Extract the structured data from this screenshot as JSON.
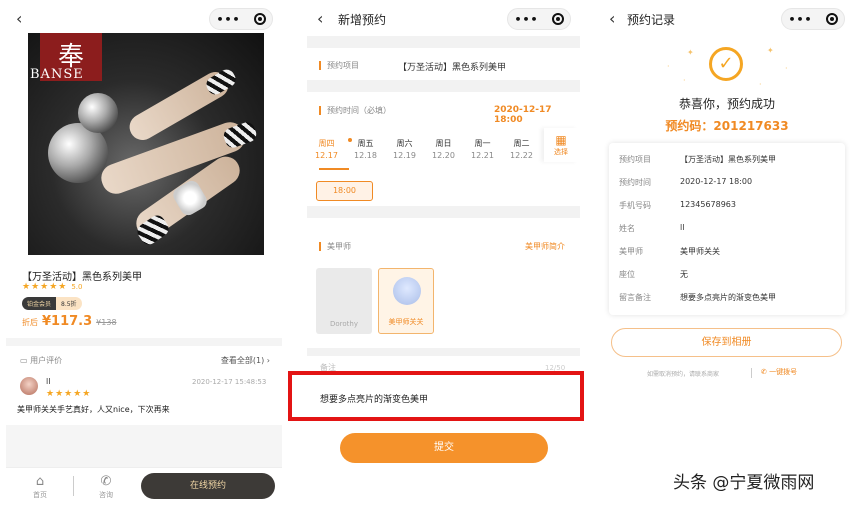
{
  "panel1": {
    "product_title": "【万圣活动】黑色系列美甲",
    "stars": "★★★★★",
    "rating": "5.0",
    "member_badge": "铂金会员",
    "discount_badge": "8.5折",
    "price_label": "折后",
    "price": "¥117.3",
    "original_price": "¥138",
    "reviews_label": "用户评价",
    "view_all": "查看全部(1)",
    "review": {
      "name": "ll",
      "date": "2020-12-17 15:48:53",
      "stars": "★★★★★",
      "text": "美甲师关关手艺真好，人又nice，下次再来"
    },
    "tabs": [
      {
        "label": "首页",
        "icon": "⌂"
      },
      {
        "label": "咨询",
        "icon": "✆"
      }
    ],
    "book_button": "在线预约",
    "photo_logo_char": "奉",
    "photo_logo_text": "BANSE"
  },
  "panel2": {
    "title": "新增预约",
    "project_label": "预约项目",
    "project_value": "【万圣活动】黑色系列美甲",
    "time_label": "预约时间（必填）",
    "time_value": "2020-12-17 18:00",
    "days": [
      {
        "week": "周四",
        "date": "12.17"
      },
      {
        "week": "周五",
        "date": "12.18"
      },
      {
        "week": "周六",
        "date": "12.19"
      },
      {
        "week": "周日",
        "date": "12.20"
      },
      {
        "week": "周一",
        "date": "12.21"
      },
      {
        "week": "周二",
        "date": "12.22"
      }
    ],
    "calendar_label": "选择",
    "time_chip": "18:00",
    "tech_label": "美甲师",
    "tech_intro": "美甲师简介",
    "techs": [
      {
        "name": "Dorothy"
      },
      {
        "name": "美甲师关关"
      }
    ],
    "note_label": "备注",
    "note_count": "12/50",
    "note_text": "想要多点亮片的渐变色美甲",
    "submit": "提交"
  },
  "panel3": {
    "title": "预约记录",
    "success": "恭喜你，预约成功",
    "code_label": "预约码：",
    "code": "201217633",
    "rows": [
      {
        "k": "预约项目",
        "v": "【万圣活动】黑色系列美甲"
      },
      {
        "k": "预约时间",
        "v": "2020-12-17 18:00"
      },
      {
        "k": "手机号码",
        "v": "12345678963"
      },
      {
        "k": "姓名",
        "v": "ll"
      },
      {
        "k": "美甲师",
        "v": "美甲师关关"
      },
      {
        "k": "座位",
        "v": "无"
      },
      {
        "k": "留言备注",
        "v": "想要多点亮片的渐变色美甲"
      }
    ],
    "save_button": "保存到相册",
    "cancel_hint": "如需取消预约，请联系商家",
    "dial": "一键拨号"
  },
  "watermark": "头条 @宁夏微雨网",
  "colors": {
    "accent": "#f08a24",
    "highlight": "#e31414",
    "dark_button": "#3d3a37"
  }
}
